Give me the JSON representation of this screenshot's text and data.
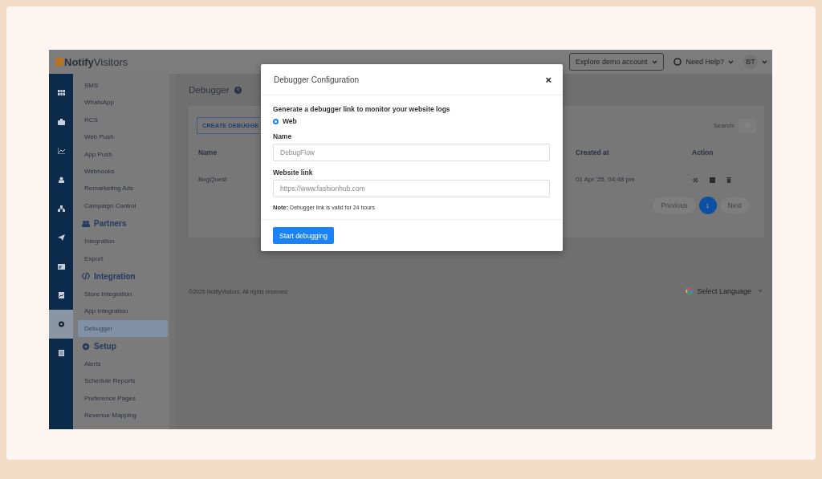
{
  "header": {
    "logo": "**Notify**Visitors",
    "demo_button": "Explore demo account",
    "help": "Need Help?",
    "avatar": "BT"
  },
  "rail": [
    {
      "selected": false
    },
    {
      "selected": false
    },
    {
      "selected": false
    },
    {
      "selected": false
    },
    {
      "selected": false
    },
    {
      "selected": false
    },
    {
      "selected": false
    },
    {
      "selected": false
    },
    {
      "selected": true
    },
    {
      "selected": false
    }
  ],
  "sidebar": {
    "items": [
      {
        "kind": "item",
        "label": "SMS",
        "selected": false
      },
      {
        "kind": "item",
        "label": "WhatsApp",
        "selected": false
      },
      {
        "kind": "item",
        "label": "RCS",
        "selected": false
      },
      {
        "kind": "item",
        "label": "Web Push",
        "selected": false
      },
      {
        "kind": "item",
        "label": "App Push",
        "selected": false
      },
      {
        "kind": "item",
        "label": "Webhooks",
        "selected": false
      },
      {
        "kind": "item",
        "label": "Remarketing Ads",
        "selected": false
      },
      {
        "kind": "item",
        "label": "Campaign Control",
        "selected": false
      },
      {
        "kind": "section",
        "label": "Partners"
      },
      {
        "kind": "item",
        "label": "Integration",
        "selected": false
      },
      {
        "kind": "item",
        "label": "Export",
        "selected": false
      },
      {
        "kind": "section",
        "label": "Integration"
      },
      {
        "kind": "item",
        "label": "Store Integration",
        "selected": false
      },
      {
        "kind": "item",
        "label": "App Integration",
        "selected": false
      },
      {
        "kind": "item",
        "label": "Debugger",
        "selected": true
      },
      {
        "kind": "section",
        "label": "Setup"
      },
      {
        "kind": "item",
        "label": "Alerts",
        "selected": false
      },
      {
        "kind": "item",
        "label": "Schedule Reports",
        "selected": false
      },
      {
        "kind": "item",
        "label": "Preference Pages",
        "selected": false
      },
      {
        "kind": "item",
        "label": "Revenue Mapping",
        "selected": false
      }
    ]
  },
  "page": {
    "title": "Debugger",
    "create_button": "CREATE DEBUGGE",
    "search_label": "Search:",
    "table": {
      "columns": [
        "Name",
        "Created at",
        "Action"
      ],
      "rows": [
        {
          "name": "BugQuest",
          "created_at": "01 Apr '25, 04:48 pm"
        }
      ]
    },
    "pagination": {
      "previous": "Previous",
      "pages": [
        {
          "label": "1",
          "selected": true
        }
      ],
      "next": "Next"
    }
  },
  "footer": {
    "copyright": "©2025 NotifyVisitors. All rights reserved",
    "language": "Select Language"
  },
  "modal": {
    "title": "Debugger Configuration",
    "close": "×",
    "intro": "Generate a debugger link to monitor your website logs",
    "options": [
      {
        "label": "Web",
        "selected": true
      }
    ],
    "fields": [
      {
        "label": "Name",
        "placeholder": "DebugFlow"
      },
      {
        "label": "Website link",
        "placeholder": "https://www.fashionhub.com"
      }
    ],
    "note": "**Note:** Debugger link is valid for 24 hours",
    "button": "Start debugging"
  }
}
